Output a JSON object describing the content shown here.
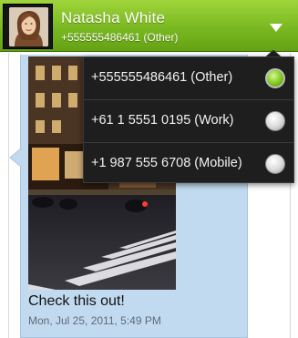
{
  "header": {
    "contact_name": "Natasha White",
    "contact_number": "+555555486461 (Other)",
    "accent_color": "#7ab821"
  },
  "message": {
    "text": "Check this out!",
    "timestamp": "Mon, Jul 25, 2011, 5:49 PM",
    "bubble_color": "#c2daf0",
    "attachment": "photo of a city street at night"
  },
  "number_menu": {
    "items": [
      {
        "label": "+555555486461 (Other)",
        "selected": true
      },
      {
        "label": "+61 1 5551  0195 (Work)",
        "selected": false
      },
      {
        "label": "+1 987 555 6708 (Mobile)",
        "selected": false
      }
    ]
  },
  "icons": {
    "dropdown": "chevron-down-icon",
    "selected": "radio-on-icon",
    "unselected": "radio-off-icon"
  }
}
